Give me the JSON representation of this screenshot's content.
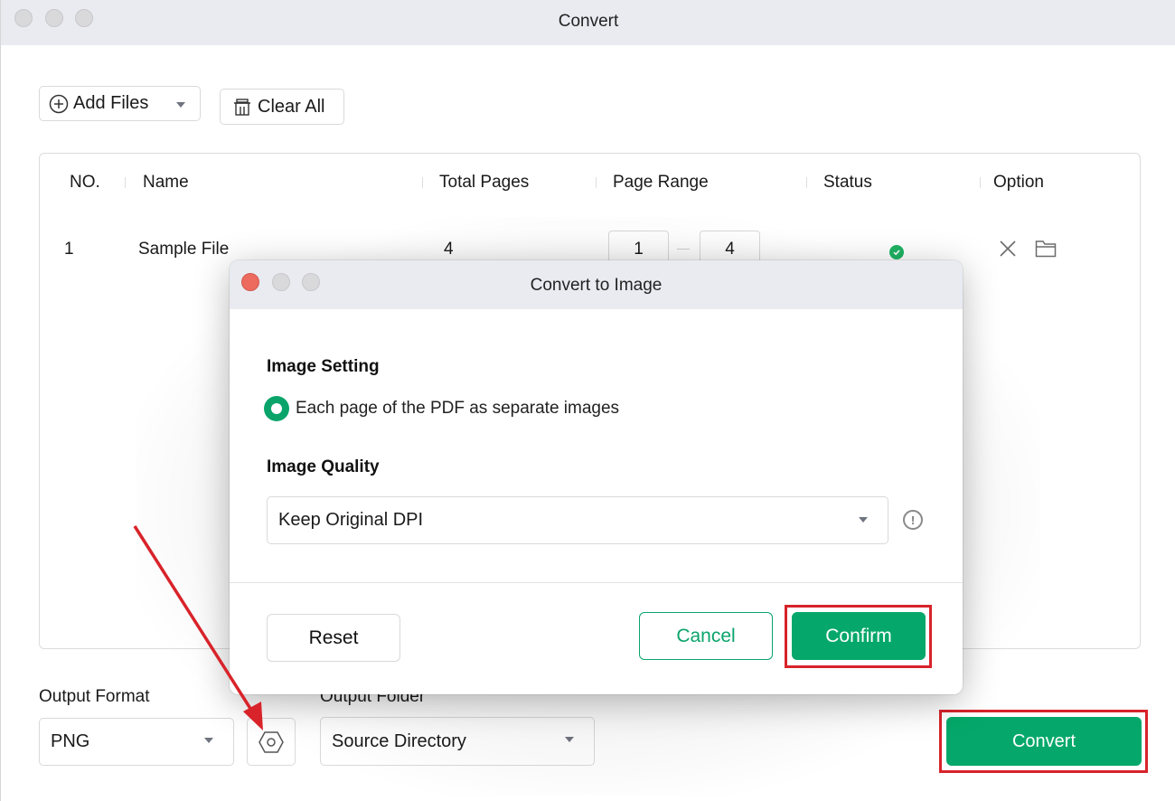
{
  "window": {
    "title": "Convert"
  },
  "toolbar": {
    "add_files_label": "Add Files",
    "clear_all_label": "Clear All"
  },
  "table": {
    "headers": [
      "NO.",
      "Name",
      "Total Pages",
      "Page Range",
      "Status",
      "Option"
    ],
    "rows": [
      {
        "no": "1",
        "name": "Sample File",
        "total_pages": "4",
        "range_from": "1",
        "range_to": "4",
        "status": "success"
      }
    ]
  },
  "output": {
    "format_label": "Output Format",
    "format_value": "PNG",
    "folder_label": "Output Folder",
    "folder_value": "Source Directory",
    "convert_label": "Convert"
  },
  "dialog": {
    "title": "Convert to Image",
    "image_setting_title": "Image Setting",
    "image_setting_option": "Each page of the PDF as separate images",
    "image_setting_selected": true,
    "image_quality_title": "Image Quality",
    "image_quality_value": "Keep Original DPI",
    "reset_label": "Reset",
    "cancel_label": "Cancel",
    "confirm_label": "Confirm"
  },
  "colors": {
    "accent_green": "#05a86a",
    "highlight_red": "#d8232a",
    "close_red": "#ec6a5e",
    "titlebar_bg": "#e9ebf1"
  },
  "annotations": {
    "highlighted": [
      "confirm-button",
      "convert-button"
    ],
    "arrow_target": "format-settings-button"
  }
}
